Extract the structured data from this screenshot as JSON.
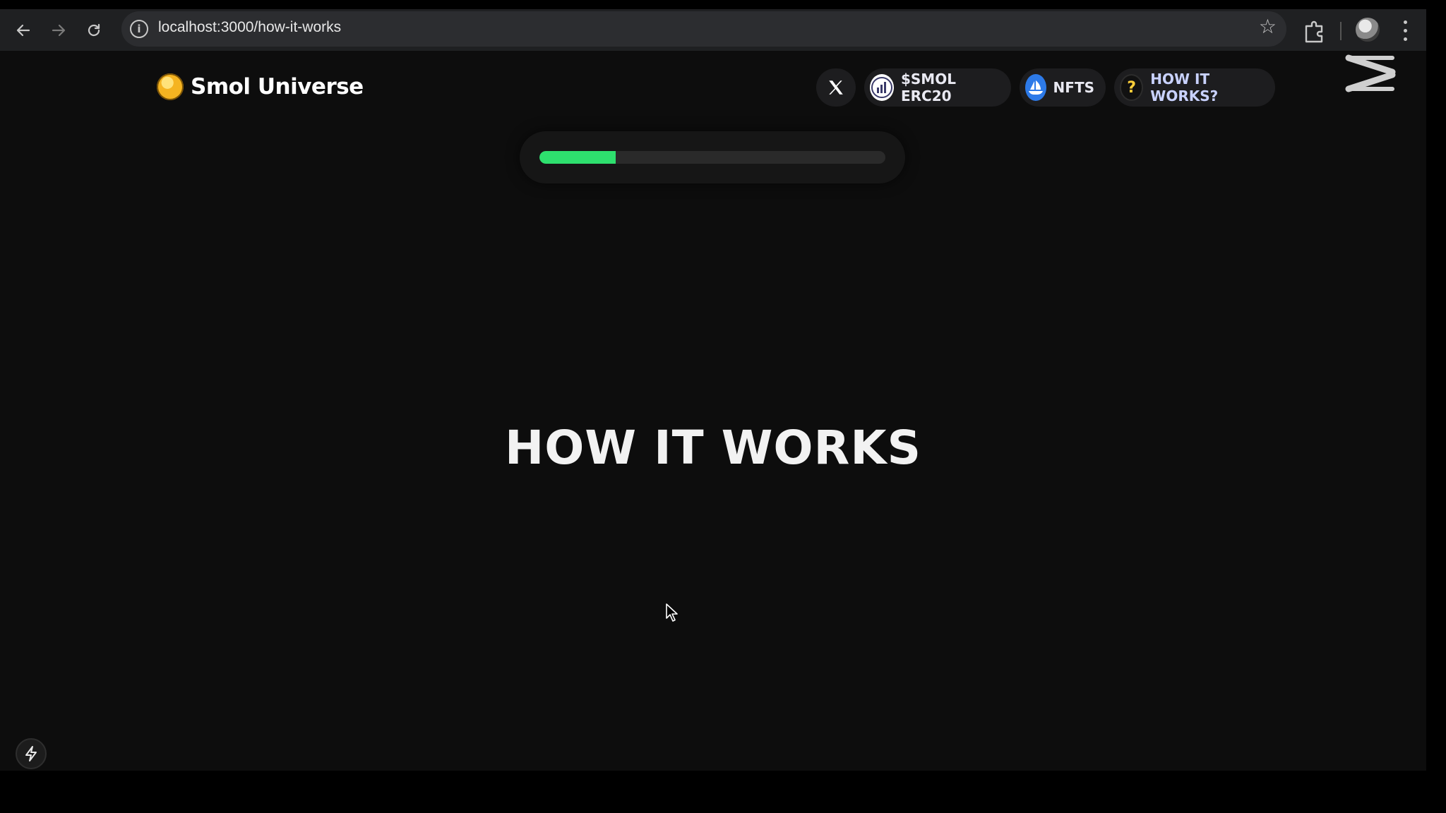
{
  "browser": {
    "url": "localhost:3000/how-it-works",
    "back_icon": "arrow-left-icon",
    "forward_icon": "arrow-right-icon",
    "reload_icon": "reload-icon"
  },
  "header": {
    "brand_name": "Smol Universe",
    "nav": {
      "smol_label": "$SMOL ERC20",
      "nfts_label": "NFTS",
      "how_label": "HOW IT WORKS?"
    }
  },
  "progress": {
    "value_percent": 22,
    "color": "#2ee06e"
  },
  "main": {
    "headline": "HOW IT WORKS"
  },
  "colors": {
    "background": "#0d0d0d",
    "pill": "#1d1d1f",
    "accent_nft": "#2d7ae8"
  }
}
